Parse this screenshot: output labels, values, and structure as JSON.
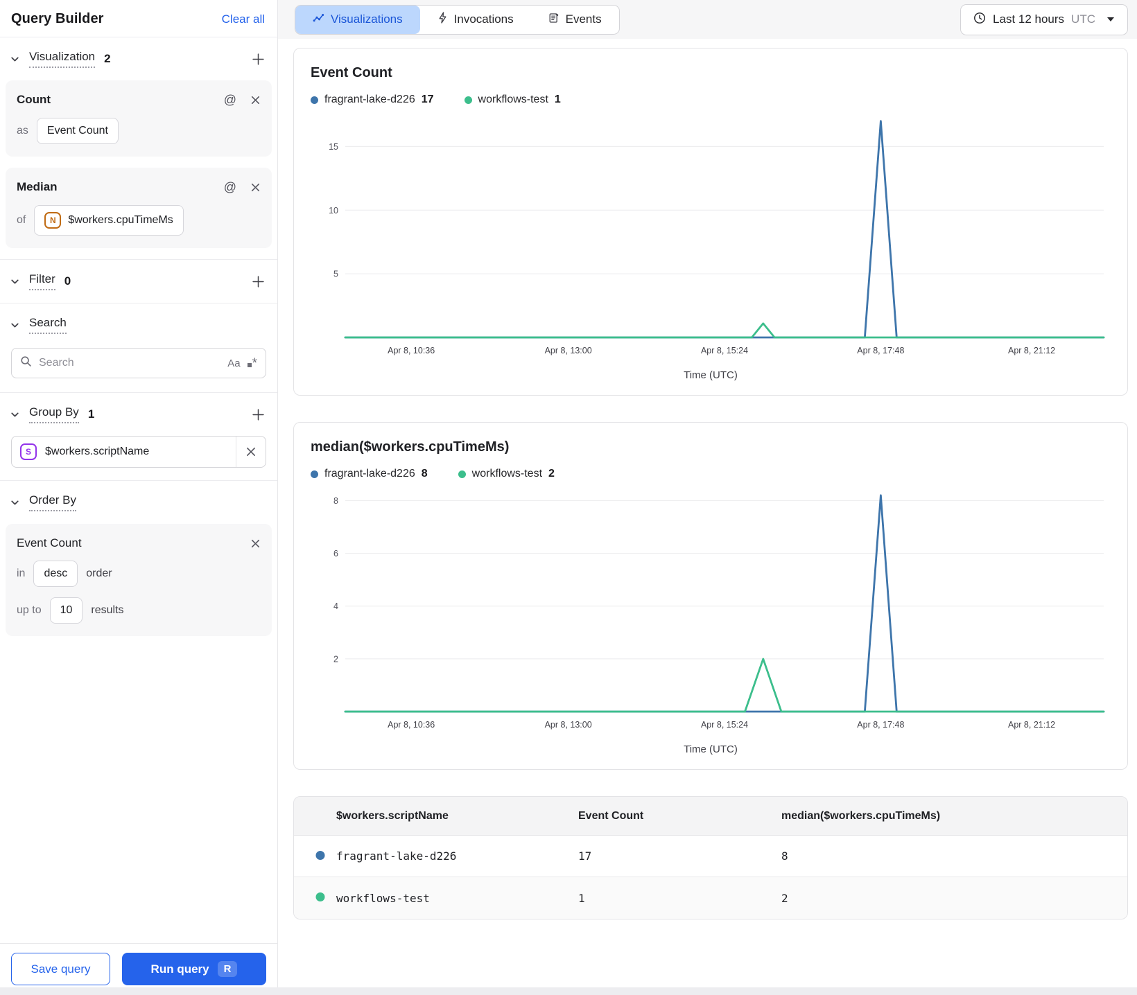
{
  "colors": {
    "accent_blue": "#2563eb",
    "active_tab_bg": "#bcd7fd",
    "series_blue": "#3e75ab",
    "series_green": "#3cbe8c"
  },
  "sidebar": {
    "title": "Query Builder",
    "clear_all": "Clear all",
    "visualization": {
      "label": "Visualization",
      "count": "2",
      "cards": [
        {
          "title": "Count",
          "prefix": "as",
          "value": "Event Count"
        },
        {
          "title": "Median",
          "prefix": "of",
          "badge": "N",
          "value": "$workers.cpuTimeMs"
        }
      ]
    },
    "filter": {
      "label": "Filter",
      "count": "0"
    },
    "search": {
      "label": "Search",
      "placeholder": "Search",
      "match_case_icon": "Aa"
    },
    "group_by": {
      "label": "Group By",
      "count": "1",
      "badge": "S",
      "value": "$workers.scriptName"
    },
    "order_by": {
      "label": "Order By",
      "card": {
        "title": "Event Count",
        "in_label": "in",
        "direction": "desc",
        "order_label": "order",
        "up_to_label": "up to",
        "limit": "10",
        "results_label": "results"
      }
    },
    "footer": {
      "save": "Save query",
      "run": "Run query",
      "shortcut": "R"
    }
  },
  "topbar": {
    "tabs": [
      {
        "label": "Visualizations",
        "active": true
      },
      {
        "label": "Invocations",
        "active": false
      },
      {
        "label": "Events",
        "active": false
      }
    ],
    "time_range": {
      "label": "Last 12 hours",
      "timezone": "UTC"
    }
  },
  "chart_data": [
    {
      "type": "line",
      "title": "Event Count",
      "xlabel": "Time (UTC)",
      "ylim": [
        0,
        17.2
      ],
      "yticks": [
        5,
        10,
        15
      ],
      "grid": true,
      "legend_position": "top",
      "xticks": [
        {
          "label": "Apr 8, 10:36",
          "pos": 0.087
        },
        {
          "label": "Apr 8, 13:00",
          "pos": 0.294
        },
        {
          "label": "Apr 8, 15:24",
          "pos": 0.5
        },
        {
          "label": "Apr 8, 17:48",
          "pos": 0.706
        },
        {
          "label": "Apr 8, 21:12",
          "pos": 0.905
        }
      ],
      "series": [
        {
          "name": "fragrant-lake-d226",
          "total": "17",
          "color": "#3e75ab",
          "points": [
            [
              0,
              0
            ],
            [
              0.685,
              0
            ],
            [
              0.706,
              17
            ],
            [
              0.727,
              0
            ],
            [
              1,
              0
            ]
          ]
        },
        {
          "name": "workflows-test",
          "total": "1",
          "color": "#3cbe8c",
          "points": [
            [
              0,
              0
            ],
            [
              0.536,
              0
            ],
            [
              0.551,
              1.1
            ],
            [
              0.566,
              0
            ],
            [
              1,
              0
            ]
          ]
        }
      ]
    },
    {
      "type": "line",
      "title": "median($workers.cpuTimeMs)",
      "xlabel": "Time (UTC)",
      "ylim": [
        0,
        8.3
      ],
      "yticks": [
        2,
        4,
        6,
        8
      ],
      "grid": true,
      "legend_position": "top",
      "xticks": [
        {
          "label": "Apr 8, 10:36",
          "pos": 0.087
        },
        {
          "label": "Apr 8, 13:00",
          "pos": 0.294
        },
        {
          "label": "Apr 8, 15:24",
          "pos": 0.5
        },
        {
          "label": "Apr 8, 17:48",
          "pos": 0.706
        },
        {
          "label": "Apr 8, 21:12",
          "pos": 0.905
        }
      ],
      "series": [
        {
          "name": "fragrant-lake-d226",
          "total": "8",
          "color": "#3e75ab",
          "points": [
            [
              0,
              0
            ],
            [
              0.685,
              0
            ],
            [
              0.706,
              8.2
            ],
            [
              0.727,
              0
            ],
            [
              1,
              0
            ]
          ]
        },
        {
          "name": "workflows-test",
          "total": "2",
          "color": "#3cbe8c",
          "points": [
            [
              0,
              0
            ],
            [
              0.527,
              0
            ],
            [
              0.551,
              2
            ],
            [
              0.575,
              0
            ],
            [
              1,
              0
            ]
          ]
        }
      ]
    }
  ],
  "table": {
    "columns": [
      "$workers.scriptName",
      "Event Count",
      "median($workers.cpuTimeMs)"
    ],
    "rows": [
      {
        "color": "#3e75ab",
        "script_name": "fragrant-lake-d226",
        "event_count": "17",
        "median": "8"
      },
      {
        "color": "#3cbe8c",
        "script_name": "workflows-test",
        "event_count": "1",
        "median": "2"
      }
    ]
  }
}
